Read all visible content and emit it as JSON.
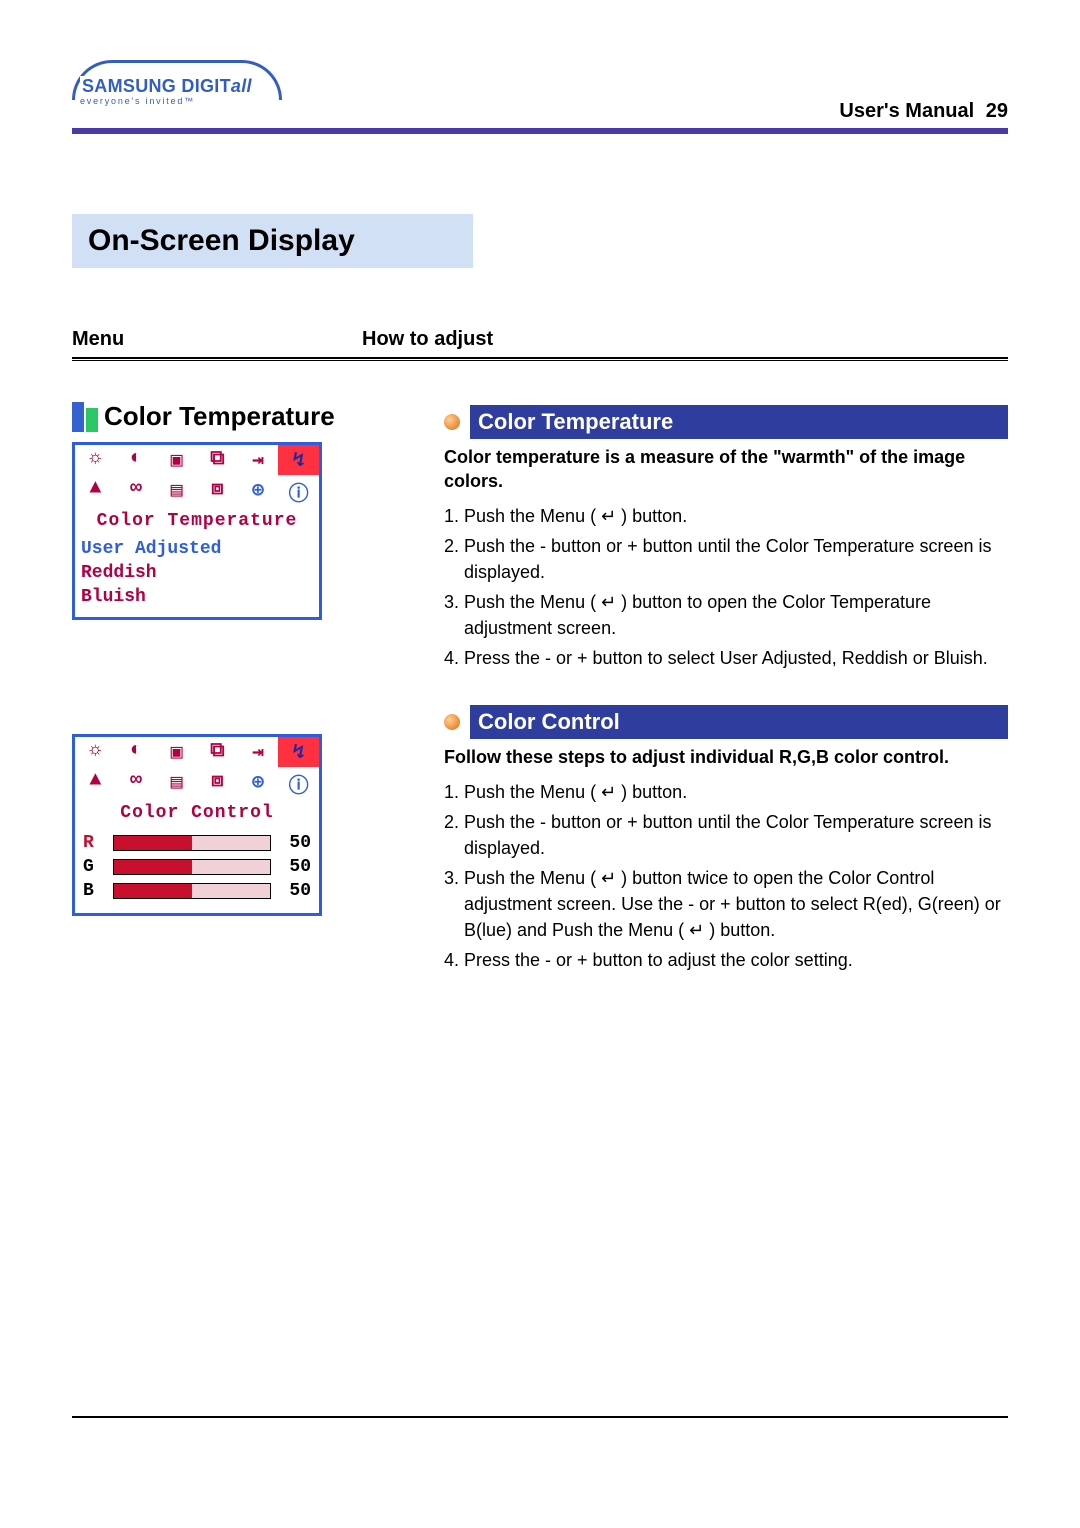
{
  "logo": {
    "brand1": "SAMSUNG DIGIT",
    "brand2": "all",
    "tagline": "everyone's invited™"
  },
  "header": {
    "label": "User's Manual",
    "page": "29"
  },
  "page_title": "On-Screen Display",
  "columns": {
    "left": "Menu",
    "right": "How to adjust"
  },
  "left_section_title": "Color Temperature",
  "osd1": {
    "title": "Color Temperature",
    "options": [
      "User Adjusted",
      "Reddish",
      "Bluish"
    ],
    "selected_index": 0,
    "icon_names": [
      "brightness-icon",
      "contrast-icon",
      "sharpness-icon",
      "pip-icon",
      "hpos-icon",
      "ok-icon",
      "warning-icon",
      "link-icon",
      "panel-icon",
      "window-icon",
      "clock-icon",
      "info-icon"
    ],
    "icon_glyphs": [
      "☼",
      "◐",
      "▣",
      "⧉",
      "⇥",
      "↯",
      "▲",
      "∞",
      "▤",
      "⧈",
      "⊕",
      "ⓘ"
    ]
  },
  "osd2": {
    "title": "Color Control",
    "rows": [
      {
        "label": "R",
        "value": 50
      },
      {
        "label": "G",
        "value": 50
      },
      {
        "label": "B",
        "value": 50
      }
    ]
  },
  "section1": {
    "title": "Color Temperature",
    "desc": "Color temperature is a measure of the \"warmth\" of the image colors.",
    "steps": [
      "Push the Menu ( ↵ ) button.",
      "Push the - button or + button until the Color Temperature screen is displayed.",
      "Push the Menu ( ↵ ) button to open the Color Temperature adjustment screen.",
      "Press the - or + button to select User Adjusted, Reddish or Bluish."
    ]
  },
  "section2": {
    "title": "Color Control",
    "desc": "Follow these steps to adjust individual R,G,B color control.",
    "steps": [
      "Push the Menu ( ↵ ) button.",
      "Push the - button or + button until the Color Temperature screen is displayed.",
      "Push the Menu ( ↵ ) button twice to open the Color Control adjustment screen. Use the - or + button to select R(ed), G(reen) or B(lue) and Push the Menu ( ↵ ) button.",
      "Press the - or + button to adjust the color setting."
    ]
  }
}
